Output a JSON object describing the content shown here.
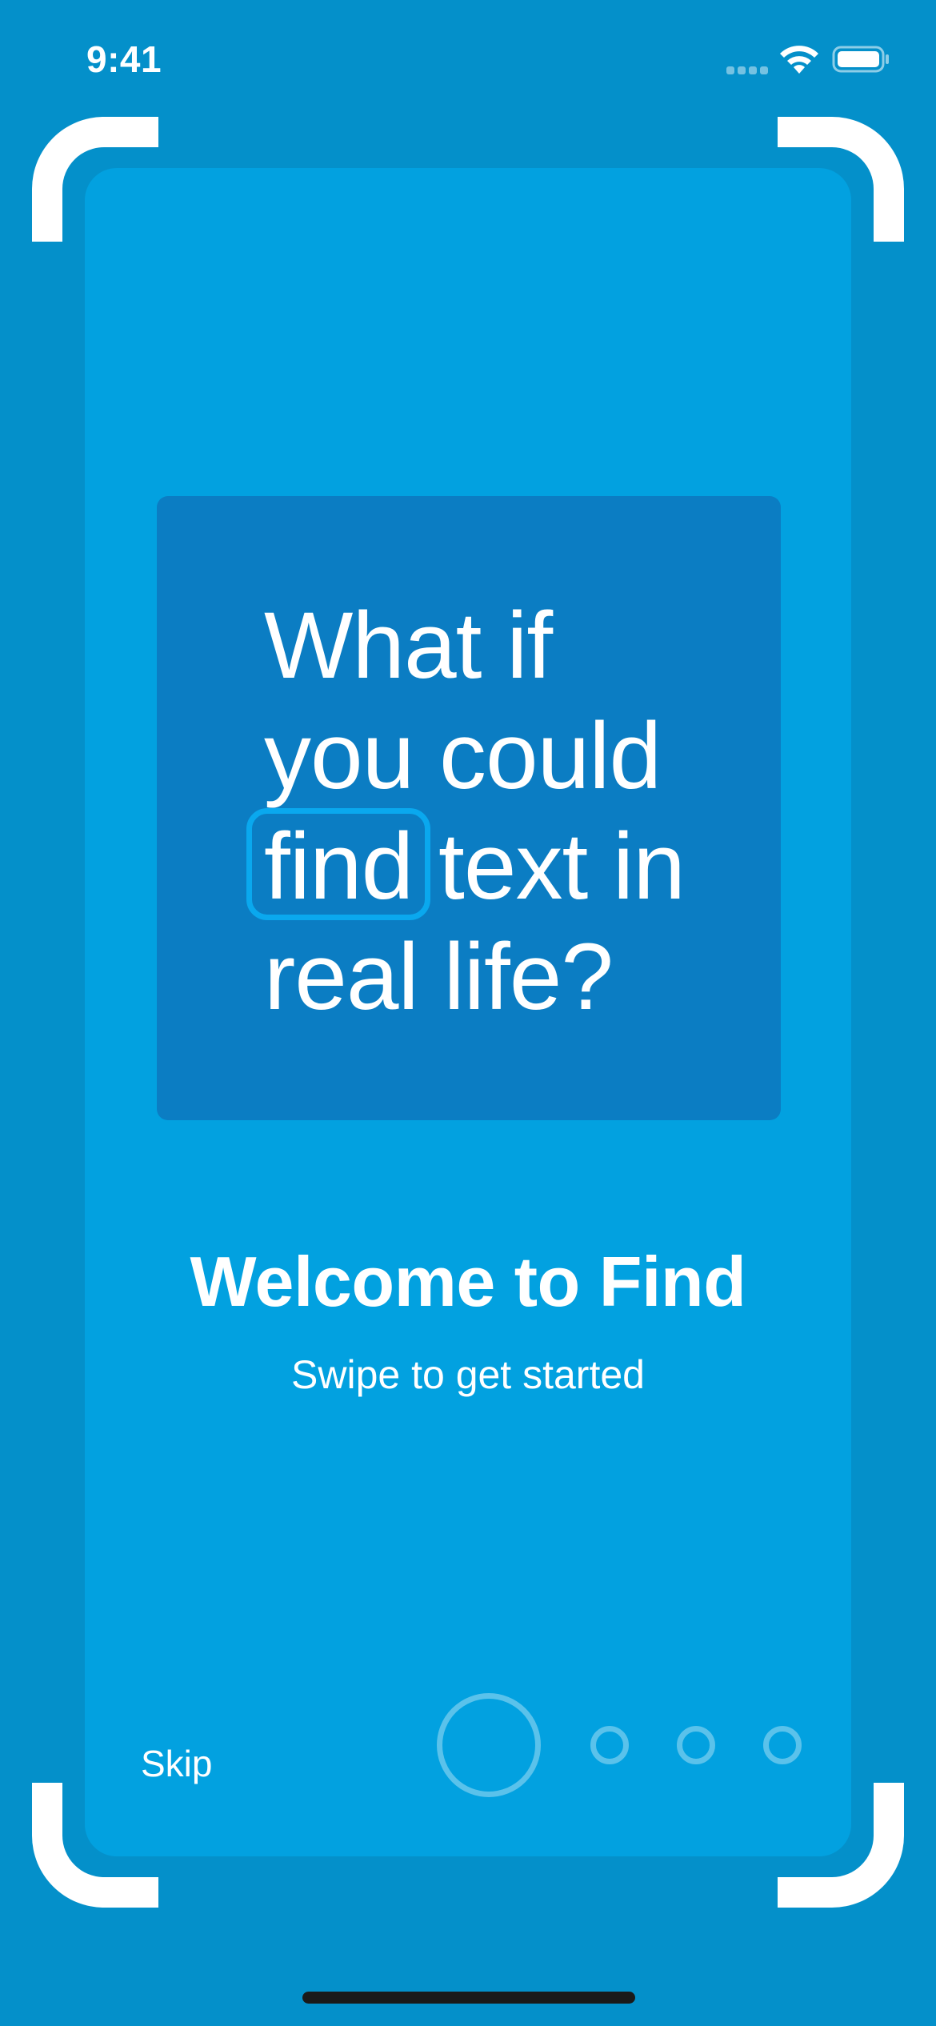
{
  "status_bar": {
    "time": "9:41",
    "icons": [
      "cellular-signal-icon",
      "wifi-icon",
      "battery-icon"
    ]
  },
  "headline": {
    "line1": "What if",
    "line2": "you could",
    "line3_highlight": "find",
    "line3_rest": " text in",
    "line4": "real life?"
  },
  "welcome": {
    "title": "Welcome to Find",
    "subtitle": "Swipe to get started"
  },
  "controls": {
    "skip_label": "Skip",
    "page_count": 4,
    "current_page": 1
  },
  "colors": {
    "background": "#0490CA",
    "card": "#02A1E0",
    "panel": "#0B7DC3",
    "highlight": "#0AA8EE",
    "text": "#FFFFFF"
  }
}
